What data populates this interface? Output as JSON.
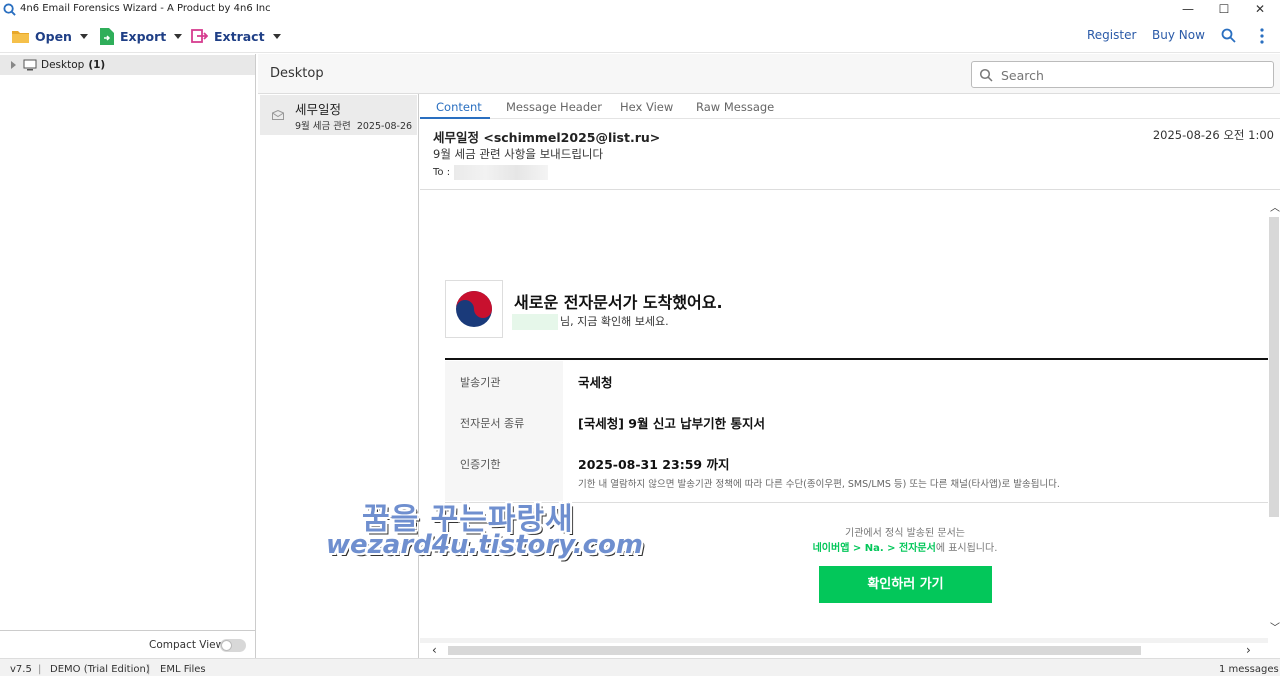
{
  "window": {
    "title": "4n6 Email Forensics Wizard - A Product by 4n6 Inc",
    "controls": [
      "—",
      "☐",
      "✕"
    ]
  },
  "toolbar": {
    "open_label": "Open",
    "export_label": "Export",
    "extract_label": "Extract",
    "register_label": "Register",
    "buy_label": "Buy Now"
  },
  "tree": {
    "root_label": "Desktop",
    "root_count": "(1)"
  },
  "compact_view_label": "Compact View",
  "breadcrumb": "Desktop",
  "search": {
    "placeholder": "Search"
  },
  "mail_list": {
    "items": [
      {
        "subject": "세무일정",
        "preview": "9월 세금 관련",
        "date": "2025-08-26"
      }
    ]
  },
  "tabs": [
    "Content",
    "Message Header",
    "Hex View",
    "Raw Message"
  ],
  "message": {
    "from": "세무일정 <schimmel2025@list.ru>",
    "date": "2025-08-26 오전 1:00",
    "subject": "9월 세금 관련 사항을 보내드립니다",
    "to_label": "To :",
    "body": {
      "headline": "새로운 전자문서가 도착했어요.",
      "subline": "님, 지금 확인해 보세요.",
      "rows": [
        {
          "label": "발송기관",
          "value": "국세청"
        },
        {
          "label": "전자문서 종류",
          "value": "[국세청] 9월 신고 납부기한 통지서"
        },
        {
          "label": "인증기한",
          "value": "2025-08-31 23:59 까지"
        }
      ],
      "deadline_note": "기한 내 열람하지 않으면 발송기관 정책에 따라 다른 수단(종이우편, SMS/LMS 등) 또는 다른 채널(타사앱)로 발송됩니다.",
      "footnote_line1": "기관에서 정식 발송된 문서는",
      "footnote_link": "네이버앱 > Na. > 전자문서",
      "footnote_tail": "에 표시됩니다.",
      "cta_label": "확인하러 가기"
    }
  },
  "watermark": {
    "line1": "꿈을 꾸는파랑새",
    "line2": "wezard4u.tistory.com"
  },
  "status": {
    "version": "v7.5",
    "edition": "DEMO (Trial Edition)",
    "file_type": "EML Files",
    "message_count": "1 messages"
  },
  "colors": {
    "accent": "#2a6fc0",
    "cta_green": "#03c75a",
    "toolbar_text": "#1f3f86"
  }
}
